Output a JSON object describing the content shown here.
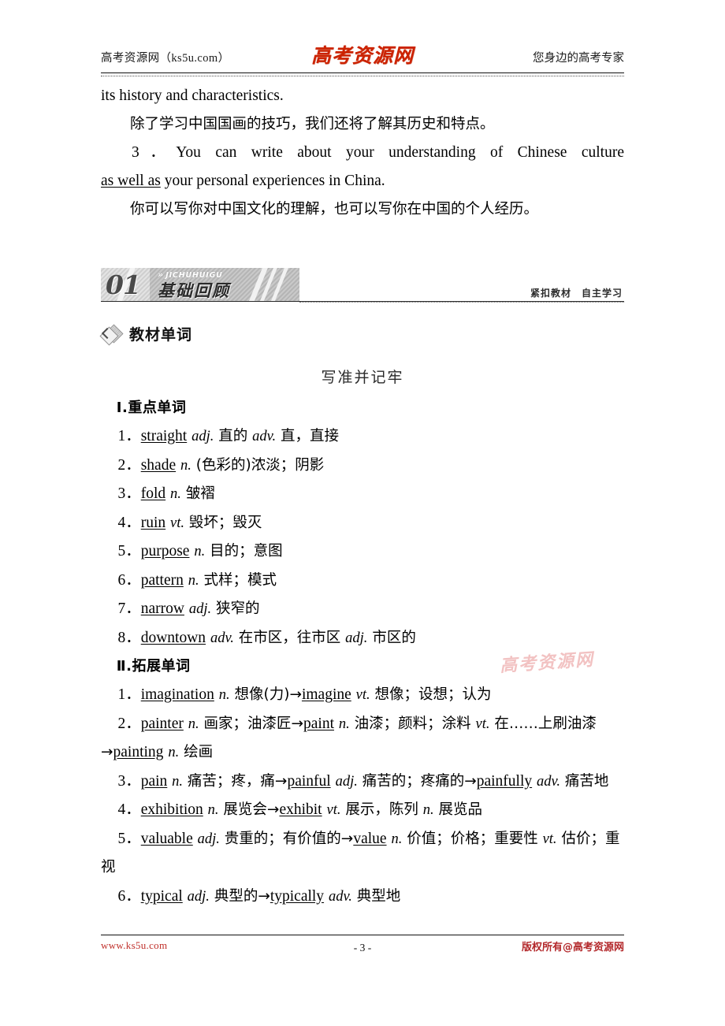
{
  "header": {
    "left_text": "高考资源网（ks5u.com）",
    "logo_text": "高考资源网",
    "right_text": "您身边的高考专家"
  },
  "body_paragraphs": [
    {
      "id": "p1",
      "text": "its history and characteristics."
    },
    {
      "id": "p2",
      "text": "除了学习中国国画的技巧，我们还将了解其历史和特点。"
    },
    {
      "id": "p3_line1",
      "text": "3．You can write about your understanding of Chinese culture"
    },
    {
      "id": "p3_line2_underlined",
      "text": "as well as"
    },
    {
      "id": "p3_line2_rest",
      "text": "your personal experiences in China."
    },
    {
      "id": "p4",
      "text": "你可以写你对中国文化的理解，也可以写你在中国的个人经历。"
    }
  ],
  "section_banner": {
    "number": "01",
    "pinyin": "JICHUHUIGU",
    "chinese_title": "基础回顾",
    "motto": "紧扣教材　自主学习",
    "chevron": "»"
  },
  "sub_heading": {
    "icon": "diamond-icon",
    "title": "教材单词"
  },
  "center_title": "写准并记牢",
  "vocabulary": {
    "group1": {
      "heading": "Ⅰ.重点单词",
      "items": [
        {
          "no": "1．",
          "word": "straight",
          "rest": " adj. 直的  adv. 直，直接"
        },
        {
          "no": "2．",
          "word": "shade",
          "rest": " n. (色彩的)浓淡；阴影"
        },
        {
          "no": "3．",
          "word": "fold",
          "rest": " n. 皱褶"
        },
        {
          "no": "4．",
          "word": "ruin",
          "rest": " vt. 毁坏；毁灭"
        },
        {
          "no": "5．",
          "word": "purpose",
          "rest": " n. 目的；意图"
        },
        {
          "no": "6．",
          "word": "pattern",
          "rest": " n. 式样；模式"
        },
        {
          "no": "7．",
          "word": "narrow",
          "rest": " adj. 狭窄的"
        },
        {
          "no": "8．",
          "word": "downtown",
          "rest": " adv. 在市区，往市区  adj. 市区的"
        }
      ]
    },
    "group2": {
      "heading": "Ⅱ.拓展单词",
      "items": [
        {
          "no": "1．",
          "parts": [
            {
              "t": "imagination",
              "u": true
            },
            {
              "t": " n. 想像(力)→",
              "u": false
            },
            {
              "t": "imagine",
              "u": true
            },
            {
              "t": " vt. 想像；设想；认为",
              "u": false
            }
          ]
        },
        {
          "no": "2．",
          "parts": [
            {
              "t": "painter",
              "u": true
            },
            {
              "t": " n. 画家；油漆匠→",
              "u": false
            },
            {
              "t": "paint",
              "u": true
            },
            {
              "t": " n. 油漆；颜料；涂料  vt. 在……上刷油漆→",
              "u": false
            },
            {
              "t": "painting",
              "u": true
            },
            {
              "t": " n. 绘画",
              "u": false
            }
          ]
        },
        {
          "no": "3．",
          "parts": [
            {
              "t": "pain",
              "u": true
            },
            {
              "t": " n. 痛苦；疼，痛→",
              "u": false
            },
            {
              "t": "painful",
              "u": true
            },
            {
              "t": " adj. 痛苦的；疼痛的→",
              "u": false
            },
            {
              "t": "painfully",
              "u": true
            },
            {
              "t": " adv. 痛苦地",
              "u": false
            }
          ]
        },
        {
          "no": "4．",
          "parts": [
            {
              "t": "exhibition",
              "u": true
            },
            {
              "t": " n. 展览会→",
              "u": false
            },
            {
              "t": "exhibit",
              "u": true
            },
            {
              "t": " vt. 展示，陈列  n. 展览品",
              "u": false
            }
          ]
        },
        {
          "no": "5．",
          "parts": [
            {
              "t": "valuable",
              "u": true
            },
            {
              "t": " adj. 贵重的；有价值的→",
              "u": false
            },
            {
              "t": "value",
              "u": true
            },
            {
              "t": " n. 价值；价格；重要性  vt. 估价；重视",
              "u": false
            }
          ]
        },
        {
          "no": "6．",
          "parts": [
            {
              "t": "typical",
              "u": true
            },
            {
              "t": " adj. 典型的→",
              "u": false
            },
            {
              "t": "typically",
              "u": true
            },
            {
              "t": " adv. 典型地",
              "u": false
            }
          ]
        }
      ]
    }
  },
  "watermark": "高考资源网",
  "footer": {
    "left_text": "www.ks5u.com",
    "page_number": "- 3 -",
    "right_text": "版权所有@高考资源网"
  },
  "colors": {
    "logo_red": "#cc2200",
    "footer_red": "#b3282b",
    "watermark_pink": "#f0b8b8",
    "banner_gray": "#c9c9c9"
  }
}
